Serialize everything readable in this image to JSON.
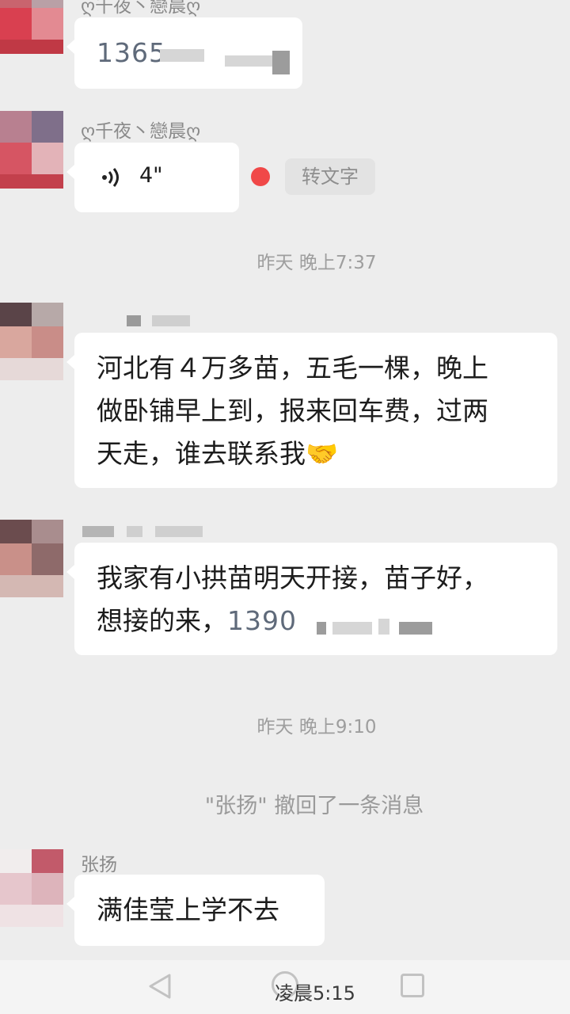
{
  "messages": [
    {
      "sender": "ღ千夜丶戀晨ღ",
      "type": "text",
      "text": "1365"
    },
    {
      "sender": "ღ千夜丶戀晨ღ",
      "type": "voice",
      "duration": "4\"",
      "convert_label": "转文字",
      "unread": true
    },
    {
      "timestamp": "昨天 晚上7:37"
    },
    {
      "type": "text",
      "text": "河北有４万多苗，五毛一棵，晚上\n做卧铺早上到，报来回车费，过两\n天走，谁去联系我🤝"
    },
    {
      "type": "text",
      "text": "我家有小拱苗明天开接，苗子好，\n想接的来，",
      "phone": "1390"
    },
    {
      "timestamp": "昨天 晚上9:10"
    },
    {
      "system": "\"张扬\" 撤回了一条消息"
    },
    {
      "sender": "张扬",
      "type": "text",
      "text": "满佳莹上学不去"
    }
  ],
  "navbar": {
    "time": "凌晨5:15"
  },
  "colors": {
    "background": "#ededed",
    "bubble": "#ffffff",
    "unread_dot": "#f04848"
  }
}
